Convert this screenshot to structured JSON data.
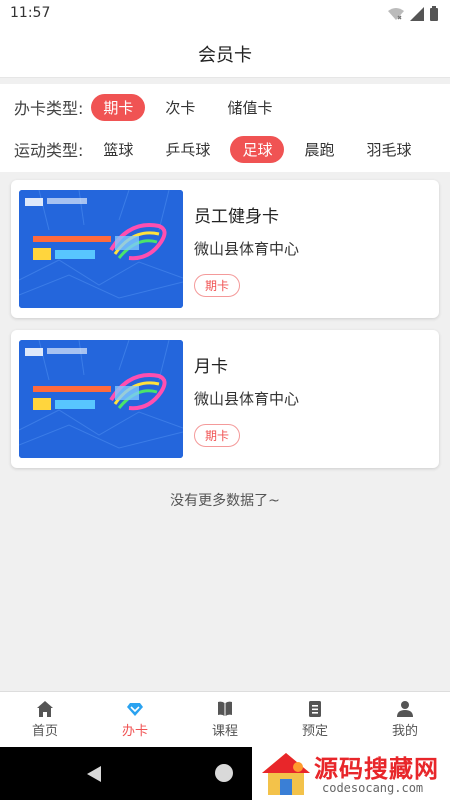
{
  "status": {
    "time": "11:57"
  },
  "header": {
    "title": "会员卡"
  },
  "filters": {
    "card_type": {
      "label": "办卡类型:",
      "options": [
        {
          "label": "期卡",
          "selected": true
        },
        {
          "label": "次卡",
          "selected": false
        },
        {
          "label": "储值卡",
          "selected": false
        }
      ]
    },
    "sport_type": {
      "label": "运动类型:",
      "options": [
        {
          "label": "篮球",
          "selected": false
        },
        {
          "label": "乒乓球",
          "selected": false
        },
        {
          "label": "足球",
          "selected": true
        },
        {
          "label": "晨跑",
          "selected": false
        },
        {
          "label": "羽毛球",
          "selected": false
        }
      ]
    }
  },
  "cards": [
    {
      "title": "员工健身卡",
      "venue": "微山县体育中心",
      "tag": "期卡"
    },
    {
      "title": "月卡",
      "venue": "微山县体育中心",
      "tag": "期卡"
    }
  ],
  "list_footer": "没有更多数据了~",
  "tabbar": {
    "items": [
      {
        "label": "首页",
        "icon": "home-icon",
        "active": false
      },
      {
        "label": "办卡",
        "icon": "diamond-icon",
        "active": true
      },
      {
        "label": "课程",
        "icon": "book-icon",
        "active": false
      },
      {
        "label": "预定",
        "icon": "clipboard-icon",
        "active": false
      },
      {
        "label": "我的",
        "icon": "user-icon",
        "active": false
      }
    ]
  },
  "watermark": {
    "text": "源码搜藏网",
    "url": "codesocang.com"
  },
  "colors": {
    "accent": "#f05353",
    "card_blue": "#2a6fe0"
  }
}
